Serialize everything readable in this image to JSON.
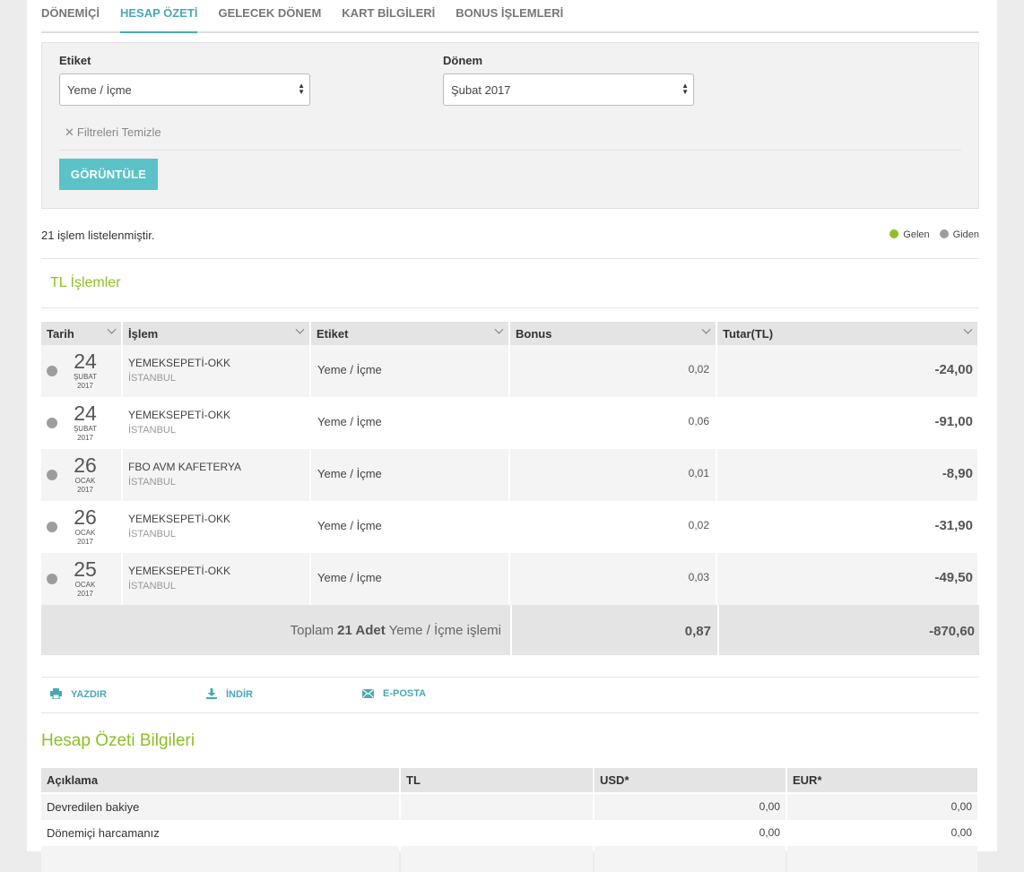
{
  "tabs": [
    {
      "label": "DÖNEMİÇİ",
      "active": false
    },
    {
      "label": "HESAP ÖZETİ",
      "active": true
    },
    {
      "label": "GELECEK DÖNEM",
      "active": false
    },
    {
      "label": "KART BİLGİLERİ",
      "active": false
    },
    {
      "label": "BONUS İŞLEMLERİ",
      "active": false
    }
  ],
  "filter": {
    "tag_label": "Etiket",
    "tag_value": "Yeme / İçme",
    "period_label": "Dönem",
    "period_value": "Şubat 2017",
    "clear_label": "Filtreleri Temizle",
    "view_button": "GÖRÜNTÜLE"
  },
  "summary": {
    "count_text": "21 işlem listelenmiştir.",
    "legend_in": "Gelen",
    "legend_out": "Giden",
    "color_in": "#8cbf26",
    "color_out": "#9d9d9d"
  },
  "tl_title": "TL İşlemler",
  "table": {
    "headers": [
      "Tarih",
      "İşlem",
      "Etiket",
      "Bonus",
      "Tutar(TL)"
    ],
    "rows": [
      {
        "day": "24",
        "month": "ŞUBAT",
        "year": "2017",
        "merchant": "YEMEKSEPETİ-OKK",
        "city": "İSTANBUL",
        "tag": "Yeme / İçme",
        "bonus": "0,02",
        "amount": "-24,00"
      },
      {
        "day": "24",
        "month": "ŞUBAT",
        "year": "2017",
        "merchant": "YEMEKSEPETİ-OKK",
        "city": "İSTANBUL",
        "tag": "Yeme / İçme",
        "bonus": "0,06",
        "amount": "-91,00"
      },
      {
        "day": "26",
        "month": "OCAK",
        "year": "2017",
        "merchant": "FBO AVM KAFETERYA",
        "city": "İSTANBUL",
        "tag": "Yeme / İçme",
        "bonus": "0,01",
        "amount": "-8,90"
      },
      {
        "day": "26",
        "month": "OCAK",
        "year": "2017",
        "merchant": "YEMEKSEPETİ-OKK",
        "city": "İSTANBUL",
        "tag": "Yeme / İçme",
        "bonus": "0,02",
        "amount": "-31,90"
      },
      {
        "day": "25",
        "month": "OCAK",
        "year": "2017",
        "merchant": "YEMEKSEPETİ-OKK",
        "city": "İSTANBUL",
        "tag": "Yeme / İçme",
        "bonus": "0,03",
        "amount": "-49,50"
      }
    ],
    "footer": {
      "prefix": "Toplam ",
      "count": "21 Adet",
      "suffix": " Yeme / İçme işlemi",
      "bonus_total": "0,87",
      "amount_total": "-870,60"
    }
  },
  "actions": {
    "print": "YAZDIR",
    "download": "İNDİR",
    "email": "E-POSTA"
  },
  "info": {
    "title": "Hesap Özeti Bilgileri",
    "headers": [
      "Açıklama",
      "TL",
      "USD*",
      "EUR*"
    ],
    "rows": [
      {
        "desc": "Devredilen bakiye",
        "tl": "",
        "usd": "0,00",
        "eur": "0,00"
      },
      {
        "desc": "Dönemiçi harcamanız",
        "tl": "",
        "usd": "0,00",
        "eur": "0,00"
      }
    ]
  }
}
